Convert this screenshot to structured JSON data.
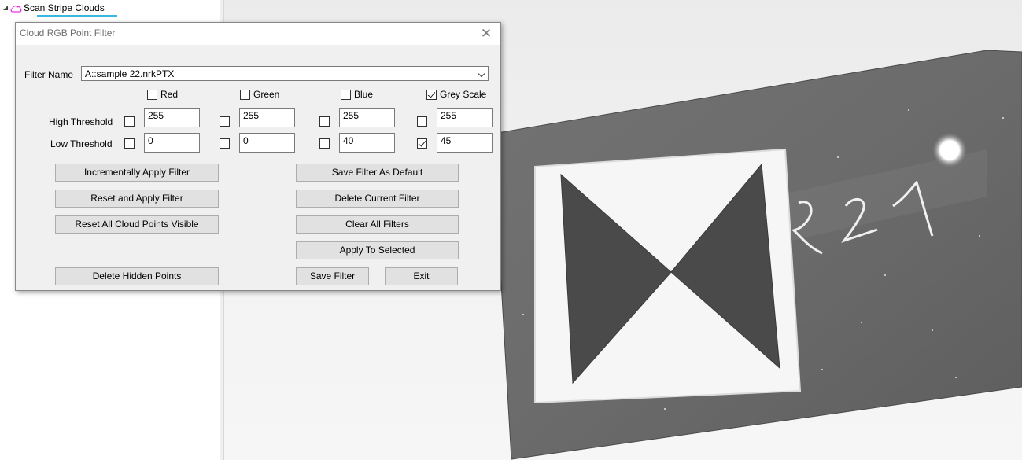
{
  "tree": {
    "root_label": "Scan Stripe Clouds",
    "expander_icon": "collapse-triangle-icon",
    "node_icon": "cloud-icon",
    "node_icon_color": "#e632e6",
    "underline_color": "#3ab6e3"
  },
  "dialog": {
    "title": "Cloud RGB Point Filter",
    "close_icon": "close-icon",
    "filter_name_label": "Filter Name",
    "filter_name_value": "A::sample 22.nrkPTX",
    "channels": [
      {
        "label": "Red",
        "checked": false,
        "high_enabled": false,
        "high": "255",
        "low_enabled": false,
        "low": "0"
      },
      {
        "label": "Green",
        "checked": false,
        "high_enabled": false,
        "high": "255",
        "low_enabled": false,
        "low": "0"
      },
      {
        "label": "Blue",
        "checked": false,
        "high_enabled": false,
        "high": "255",
        "low_enabled": false,
        "low": "40"
      },
      {
        "label": "Grey Scale",
        "checked": true,
        "high_enabled": false,
        "high": "255",
        "low_enabled": true,
        "low": "45"
      }
    ],
    "high_threshold_label": "High Threshold",
    "low_threshold_label": "Low Threshold",
    "buttons": {
      "incremental": "Incrementally Apply Filter",
      "reset_apply": "Reset and Apply Filter",
      "reset_visible": "Reset All Cloud Points Visible",
      "delete_hidden": "Delete Hidden Points",
      "save_default": "Save Filter As Default",
      "delete_current": "Delete Current Filter",
      "clear_all": "Clear All Filters",
      "apply_selected": "Apply To Selected",
      "save_filter": "Save Filter",
      "exit": "Exit"
    }
  },
  "viewport": {
    "description_marker_text": "R21",
    "background_color": "#efefef",
    "card_color": "#6a6a6a",
    "target_fill_color": "#4d4d4d"
  }
}
